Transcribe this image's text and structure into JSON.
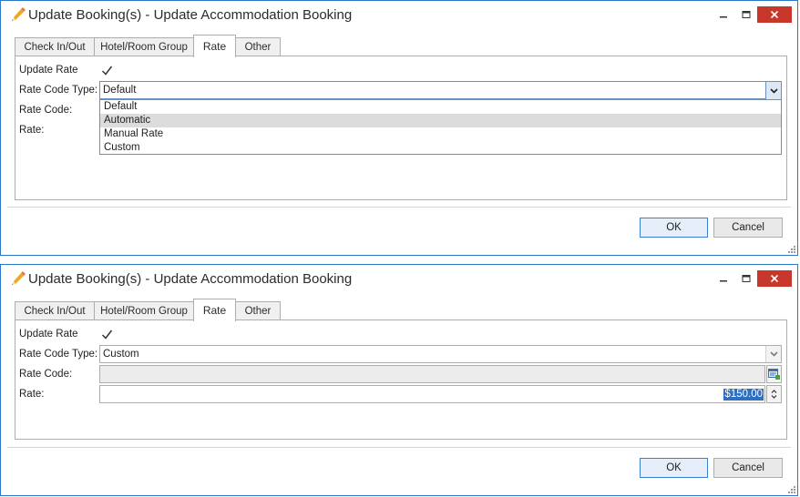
{
  "dialog": {
    "title": "Update Booking(s) - Update Accommodation Booking",
    "tabs": [
      "Check In/Out",
      "Hotel/Room Group",
      "Rate",
      "Other"
    ],
    "active_tab": "Rate",
    "labels": {
      "update_rate": "Update Rate",
      "rate_code_type": "Rate Code Type:",
      "rate_code": "Rate Code:",
      "rate": "Rate:"
    },
    "buttons": {
      "ok": "OK",
      "cancel": "Cancel"
    }
  },
  "state1": {
    "update_rate_checked": true,
    "rate_code_type": "Default",
    "dropdown_open": true,
    "dropdown_options": [
      "Default",
      "Automatic",
      "Manual Rate",
      "Custom"
    ],
    "highlighted_option": "Automatic"
  },
  "state2": {
    "update_rate_checked": true,
    "rate_code_type": "Custom",
    "rate_code": "",
    "rate_value": "$150.00"
  },
  "icons": {
    "title": "pencil-icon",
    "minimize": "minimize-icon",
    "maximize": "maximize-icon",
    "close": "close-icon",
    "dropdown": "chevron-down-icon",
    "lookup": "lookup-list-icon",
    "spinner": "spin-up-down-icon"
  },
  "colors": {
    "window_border": "#2b78c8",
    "close_button": "#c7372b",
    "selection": "#2f6fc0",
    "highlight": "#dcdcdc"
  }
}
